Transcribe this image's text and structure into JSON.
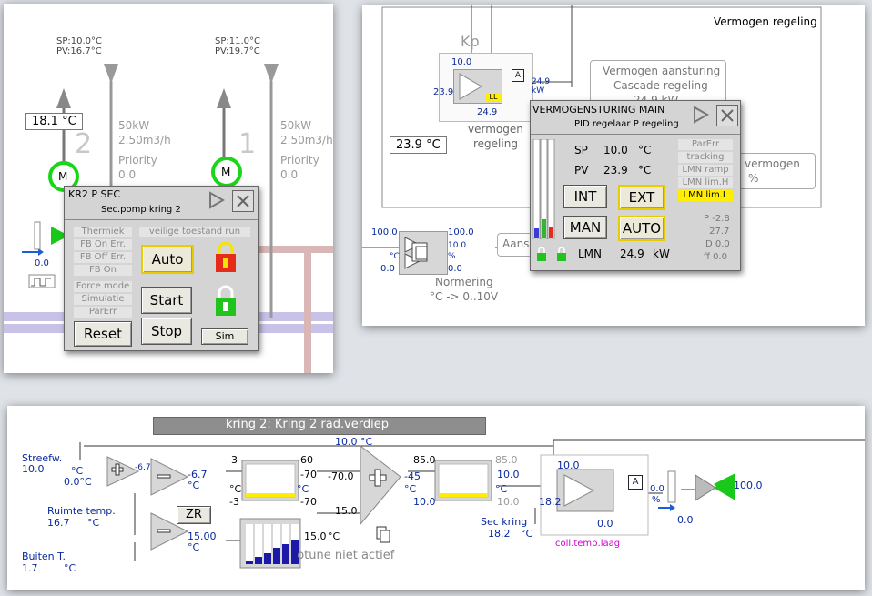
{
  "panel_top_left": {
    "pump2": {
      "number": "2",
      "sp": "SP:10.0°C",
      "pv": "PV:16.7°C",
      "power": "50kW",
      "flow": "2.50m3/h",
      "priority_label": "Priority",
      "priority_value": "0.0",
      "temp": "18.1 °C",
      "motor": "M"
    },
    "pump1": {
      "number": "1",
      "sp": "SP:11.0°C",
      "pv": "PV:19.7°C",
      "power": "50kW",
      "flow": "2.50m3/h",
      "priority_label": "Priority",
      "priority_value": "0.0",
      "motor": "M"
    },
    "left_value": "0.0",
    "popup": {
      "title": "KR2 P SEC",
      "subtitle": "Sec.pomp kring 2",
      "status_labels": [
        "Thermiek",
        "FB On Err.",
        "FB Off Err.",
        "FB On",
        "Force mode",
        "Simulatie",
        "ParErr"
      ],
      "safe_label": "veilige toestand run",
      "auto_btn": "Auto",
      "start_btn": "Start",
      "stop_btn": "Stop",
      "reset_btn": "Reset",
      "sim_btn": "Sim",
      "lock_red": "#e52b1a",
      "lock_green": "#22c21f"
    }
  },
  "panel_top_right": {
    "header": "Vermogen regeling",
    "kp_label": "Kp",
    "kp_value": "10.0",
    "kp_in": "23.9",
    "kp_out": "24.9",
    "kp_right": "24.9",
    "kp_right_unit": "kW",
    "a_badge": "A",
    "ll_badge": "LL",
    "verm_label": "vermogen",
    "regeling_label": "regeling",
    "temp_box": "23.9 °C",
    "aanst_line1": "Vermogen aansturing",
    "aanst_line2": "Cascade regeling",
    "aanst_line3": "24.9 kW",
    "verm_right1": "vermogen",
    "verm_right2": "%",
    "norm_in": "100.0",
    "norm_in_unit": "°C",
    "norm_in_min": "0.0",
    "norm_out": "100.0",
    "norm_out2": "10.0",
    "norm_out_unit": "%",
    "norm_out_min": "0.0",
    "norm_label": "Normering",
    "norm_sub": "°C -> 0..10V",
    "aans_short": "Aans",
    "pid": {
      "title": "VERMOGENSTURING MAIN",
      "subtitle": "PID regelaar P regeling",
      "sp_label": "SP",
      "sp_value": "10.0",
      "sp_unit": "°C",
      "pv_label": "PV",
      "pv_value": "23.9",
      "pv_unit": "°C",
      "int_btn": "INT",
      "ext_btn": "EXT",
      "man_btn": "MAN",
      "auto_btn": "AUTO",
      "lmn_label": "LMN",
      "lmn_value": "24.9",
      "lmn_unit": "kW",
      "flags": [
        "ParErr",
        "tracking",
        "LMN ramp",
        "LMN lim.H"
      ],
      "active_flag": "LMN lim.L",
      "p": "P -2.8",
      "i": "I 27.7",
      "d": "D 0.0",
      "ff": "ff 0.0"
    }
  },
  "panel_bottom": {
    "title": "kring 2: Kring 2 rad.verdiep",
    "streefw_label": "Streefw.",
    "streefw_value": "10.0",
    "sum1_a": "-6.7",
    "sum1_out": "0.0°C",
    "unit_c": "°C",
    "sub1_out": "-6.7",
    "ruimte_label": "Ruimte temp.",
    "ruimte_value": "16.7",
    "buiten_label": "Buiten T.",
    "buiten_value": "1.7",
    "zr_btn": "ZR",
    "sub2_out": "15.00",
    "lim1_top": "3",
    "lim1_bot": "-3",
    "lim1_r1": "60",
    "lim1_r2": "-70",
    "lim1_r3": "-70",
    "top_value": "10.0",
    "sum2_in": "-70.0",
    "sum2_in2": "15.0",
    "sum2_out": "-45",
    "sum2_top": "85.0",
    "sum2_bot": "10.0",
    "lim2_r1": "85.0",
    "lim2_r2": "10.0",
    "lim2_r3": "10.0",
    "bar_value": "15.0",
    "autotune": "Autotune niet actief",
    "pid_sp": "10.0",
    "pid_in": "18.2",
    "pid_out": "0.0",
    "pid_a": "A",
    "pid_name": "coll.temp.laag",
    "sec_kring_label": "Sec kring",
    "sec_kring_value": "18.2",
    "valve_out": "0.0",
    "valve_unit": "%",
    "valve_val": "0.0",
    "valve_right": "100.0"
  }
}
